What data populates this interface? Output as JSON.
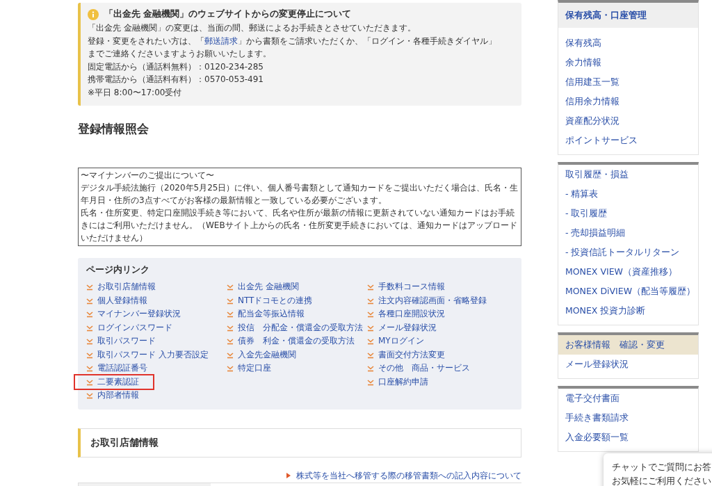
{
  "notice": {
    "title": "「出金先 金融機関」のウェブサイトからの変更停止について",
    "lines": [
      "「出金先 金融機関」の変更は、当面の間、郵送によるお手続きとさせていただきます。",
      {
        "text": "登録・変更をされたい方は、「",
        "link": "郵送請求",
        "after": "」から書類をご請求いただくか、「ログイン・各種手続きダイヤル」"
      },
      "までご連絡くださいますようお願いいたします。",
      "固定電話から（通話料無料）：0120-234-285",
      "携帯電話から（通話料有料）：0570-053-491",
      "※平日 8:00〜17:00受付"
    ]
  },
  "page_title": "登録情報照会",
  "mynumber_box": {
    "lines": [
      "〜マイナンバーのご提出について〜",
      "デジタル手続法施行（2020年5月25日）に伴い、個人番号書類として通知カードをご提出いただく場合は、氏名・生年月日・住所の3点すべてがお客様の最新情報と一致している必要がございます。",
      "氏名・住所変更、特定口座開設手続き等において、氏名や住所が最新の情報に更新されていない通知カードはお手続きにはご利用いただけません。（WEBサイト上からの氏名・住所変更手続きにおいては、通知カードはアップロードいただけません）"
    ]
  },
  "page_links": {
    "title": "ページ内リンク",
    "columns": [
      [
        {
          "label": "お取引店舗情報",
          "highlighted": false
        },
        {
          "label": "個人登録情報",
          "highlighted": false
        },
        {
          "label": "マイナンバー登録状況",
          "highlighted": false
        },
        {
          "label": "ログインパスワード",
          "highlighted": false
        },
        {
          "label": "取引パスワード",
          "highlighted": false
        },
        {
          "label": "取引パスワード 入力要否設定",
          "highlighted": false
        },
        {
          "label": "電話認証番号",
          "highlighted": false
        },
        {
          "label": "二要素認証",
          "highlighted": true
        },
        {
          "label": "内部者情報",
          "highlighted": false
        }
      ],
      [
        {
          "label": "出金先 金融機関",
          "highlighted": false
        },
        {
          "label": "NTTドコモとの連携",
          "highlighted": false
        },
        {
          "label": "配当金等振込情報",
          "highlighted": false
        },
        {
          "label": "投信　分配金・償還金の受取方法",
          "highlighted": false
        },
        {
          "label": "債券　利金・償還金の受取方法",
          "highlighted": false
        },
        {
          "label": "入金先金融機関",
          "highlighted": false
        },
        {
          "label": "特定口座",
          "highlighted": false
        }
      ],
      [
        {
          "label": "手数料コース情報",
          "highlighted": false
        },
        {
          "label": "注文内容確認画面・省略登録",
          "highlighted": false
        },
        {
          "label": "各種口座開設状況",
          "highlighted": false
        },
        {
          "label": "メール登録状況",
          "highlighted": false
        },
        {
          "label": "MYログイン",
          "highlighted": false
        },
        {
          "label": "書面交付方法変更",
          "highlighted": false
        },
        {
          "label": "その他　商品・サービス",
          "highlighted": false
        },
        {
          "label": "口座解約申請",
          "highlighted": false
        }
      ]
    ]
  },
  "section": {
    "title": "お取引店舗情報",
    "link": "株式等を当社へ移管する際の移管書類への記入内容について"
  },
  "sidebar": {
    "groups": [
      {
        "items": [
          {
            "label": "保有残高・口座管理",
            "kind": "header",
            "selected": false
          },
          {
            "label": "保有残高",
            "kind": "link",
            "selected": false
          },
          {
            "label": "余力情報",
            "kind": "link",
            "selected": false
          },
          {
            "label": "信用建玉一覧",
            "kind": "link",
            "selected": false
          },
          {
            "label": "信用余力情報",
            "kind": "link",
            "selected": false
          },
          {
            "label": "資産配分状況",
            "kind": "link",
            "selected": false
          },
          {
            "label": "ポイントサービス",
            "kind": "link",
            "selected": false
          }
        ]
      },
      {
        "items": [
          {
            "label": "取引履歴・損益",
            "kind": "link",
            "selected": false
          },
          {
            "label": "- 精算表",
            "kind": "link",
            "selected": false
          },
          {
            "label": "- 取引履歴",
            "kind": "link",
            "selected": false
          },
          {
            "label": "- 売却損益明細",
            "kind": "link",
            "selected": false
          },
          {
            "label": "- 投資信託トータルリターン",
            "kind": "link",
            "selected": false
          },
          {
            "label": "MONEX VIEW（資産推移）",
            "kind": "link",
            "selected": false
          },
          {
            "label": "MONEX DiVIEW（配当等履歴）",
            "kind": "link",
            "selected": false
          },
          {
            "label": "MONEX 投資力診断",
            "kind": "link",
            "selected": false
          }
        ]
      },
      {
        "items": [
          {
            "label": "お客様情報　確認・変更",
            "kind": "link",
            "selected": true
          },
          {
            "label": "メール登録状況",
            "kind": "link",
            "selected": false
          }
        ]
      },
      {
        "items": [
          {
            "label": "電子交付書面",
            "kind": "link",
            "selected": false
          },
          {
            "label": "手続き書類請求",
            "kind": "link",
            "selected": false
          },
          {
            "label": "入金必要額一覧",
            "kind": "link",
            "selected": false
          }
        ]
      }
    ]
  },
  "chat_popup": {
    "lines": [
      "チャットでご質問にお答",
      "お気軽にご利用ください"
    ]
  }
}
